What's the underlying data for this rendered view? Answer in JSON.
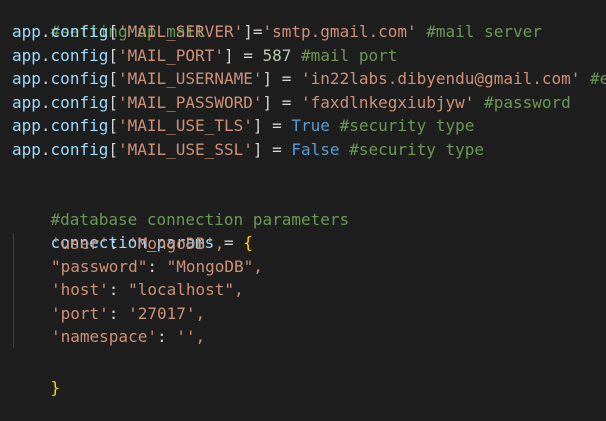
{
  "editor": {
    "comments": {
      "setup": "#setting up mail",
      "db": "#database connection parameters"
    },
    "config": [
      {
        "obj": "app",
        "attr": "config",
        "key": "'MAIL_SERVER'",
        "op": "=",
        "value": "'smtp.gmail.com'",
        "value_type": "str",
        "comment": "#mail server"
      },
      {
        "obj": "app",
        "attr": "config",
        "key": "'MAIL_PORT'",
        "op": " = ",
        "value": "587",
        "value_type": "num",
        "comment": "#mail port"
      },
      {
        "obj": "app",
        "attr": "config",
        "key": "'MAIL_USERNAME'",
        "op": " = ",
        "value": "'in22labs.dibyendu@gmail.com'",
        "value_type": "str",
        "comment": "#e"
      },
      {
        "obj": "app",
        "attr": "config",
        "key": "'MAIL_PASSWORD'",
        "op": " = ",
        "value": "'faxdlnkegxiubjyw'",
        "value_type": "str",
        "comment": "#password"
      },
      {
        "obj": "app",
        "attr": "config",
        "key": "'MAIL_USE_TLS'",
        "op": " = ",
        "value": "True",
        "value_type": "const",
        "comment": "#security type"
      },
      {
        "obj": "app",
        "attr": "config",
        "key": "'MAIL_USE_SSL'",
        "op": " = ",
        "value": "False",
        "value_type": "const",
        "comment": "#security type"
      }
    ],
    "dict": {
      "name": "connection_params",
      "op": " = ",
      "open": "{",
      "close": "}",
      "entries": [
        {
          "key": "'user'",
          "sep": ": ",
          "value": "'MongoDB',"
        },
        {
          "key": "\"password\"",
          "sep": ": ",
          "value": "\"MongoDB\","
        },
        {
          "key": "'host'",
          "sep": ": ",
          "value": "\"localhost\","
        },
        {
          "key": "'port'",
          "sep": ": ",
          "value": "'27017',"
        },
        {
          "key": "'namespace'",
          "sep": ": ",
          "value": "'',"
        }
      ]
    }
  }
}
